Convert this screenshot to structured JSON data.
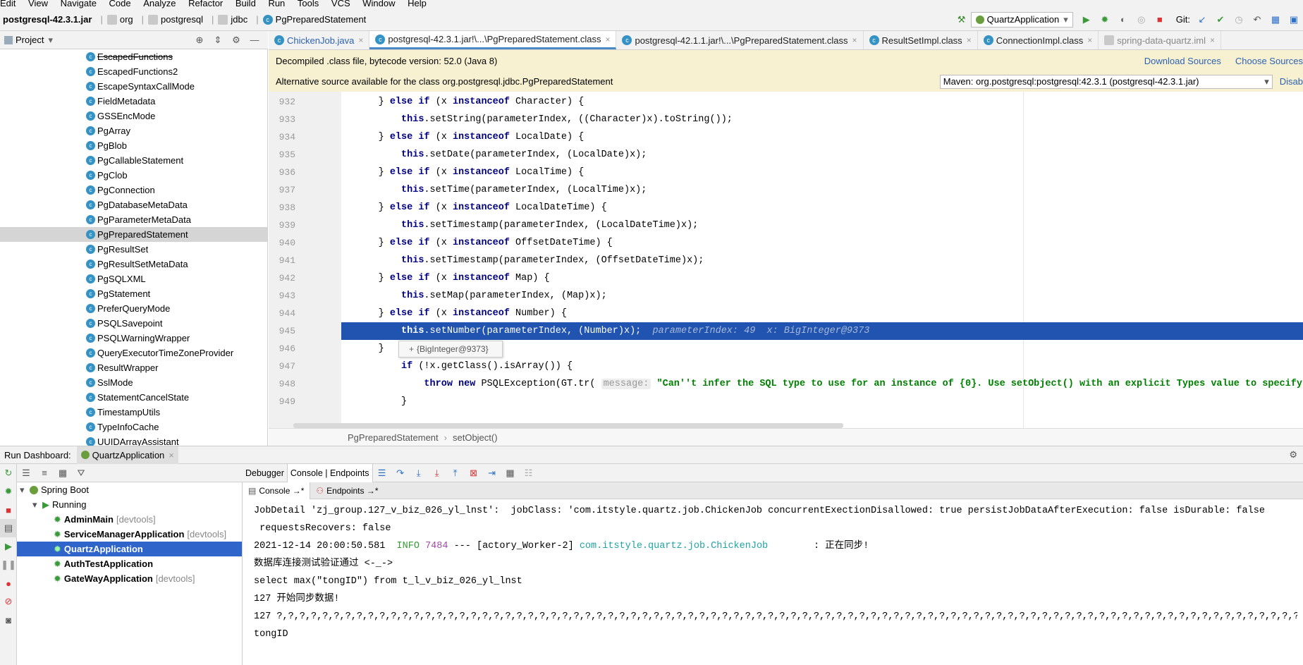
{
  "menu": [
    "Edit",
    "View",
    "Navigate",
    "Code",
    "Analyze",
    "Refactor",
    "Build",
    "Run",
    "Tools",
    "VCS",
    "Window",
    "Help"
  ],
  "nav": {
    "jar": "postgresql-42.3.1.jar",
    "p1": "org",
    "p2": "postgresql",
    "p3": "jdbc",
    "cls": "PgPreparedStatement",
    "run_config": "QuartzApplication",
    "git": "Git:"
  },
  "project": {
    "title": "Project",
    "items": [
      "EscapedFunctions",
      "EscapedFunctions2",
      "EscapeSyntaxCallMode",
      "FieldMetadata",
      "GSSEncMode",
      "PgArray",
      "PgBlob",
      "PgCallableStatement",
      "PgClob",
      "PgConnection",
      "PgDatabaseMetaData",
      "PgParameterMetaData",
      "PgPreparedStatement",
      "PgResultSet",
      "PgResultSetMetaData",
      "PgSQLXML",
      "PgStatement",
      "PreferQueryMode",
      "PSQLSavepoint",
      "PSQLWarningWrapper",
      "QueryExecutorTimeZoneProvider",
      "ResultWrapper",
      "SslMode",
      "StatementCancelState",
      "TimestampUtils",
      "TypeInfoCache",
      "UUIDArrayAssistant"
    ],
    "selected": 12
  },
  "tabs": [
    "ChickenJob.java",
    "postgresql-42.3.1.jar!\\...\\PgPreparedStatement.class",
    "postgresql-42.1.1.jar!\\...\\PgPreparedStatement.class",
    "ResultSetImpl.class",
    "ConnectionImpl.class",
    "spring-data-quartz.iml"
  ],
  "banner1": {
    "text": "Decompiled .class file, bytecode version: 52.0 (Java 8)",
    "download": "Download Sources",
    "choose": "Choose Sources"
  },
  "banner2": {
    "text": "Alternative source available for the class org.postgresql.jdbc.PgPreparedStatement",
    "select": "Maven: org.postgresql:postgresql:42.3.1 (postgresql-42.3.1.jar)",
    "disable": "Disab"
  },
  "code": {
    "lines": [
      "932",
      "933",
      "934",
      "935",
      "936",
      "937",
      "938",
      "939",
      "940",
      "941",
      "942",
      "943",
      "944",
      "945",
      "946",
      "947",
      "948",
      "949"
    ],
    "tooltip": "{BigInteger@9373}",
    "inline": "parameterIndex: 49  x: BigInteger@9373",
    "hint_label": "message:",
    "message_str": "\"Can''t infer the SQL type to use for an instance of {0}. Use setObject() with an explicit Types value to specify"
  },
  "breadcrumb": {
    "cls": "PgPreparedStatement",
    "method": "setObject()"
  },
  "run_dashboard": {
    "label": "Run Dashboard:",
    "app": "QuartzApplication",
    "spring_boot": "Spring Boot",
    "running": "Running",
    "apps": [
      {
        "name": "AdminMain",
        "tag": "[devtools]"
      },
      {
        "name": "ServiceManagerApplication",
        "tag": "[devtools]"
      },
      {
        "name": "QuartzApplication",
        "tag": ""
      },
      {
        "name": "AuthTestApplication",
        "tag": ""
      },
      {
        "name": "GateWayApplication",
        "tag": "[devtools]"
      }
    ]
  },
  "debug_tabs": {
    "debugger": "Debugger",
    "console": "Console | Endpoints",
    "sub_console": "Console →*",
    "sub_endpoints": "Endpoints →*"
  },
  "console_lines": [
    "JobDetail 'zj_group.127_v_biz_026_yl_lnst':  jobClass: 'com.itstyle.quartz.job.ChickenJob concurrentExectionDisallowed: true persistJobDataAfterExecution: false isDurable: false",
    " requestsRecovers: false",
    "2021-12-14 20:00:50.581  INFO 7484 --- [actory_Worker-2] com.itstyle.quartz.job.ChickenJob        : 正在同步!",
    "数据库连接测试验证通过 <-_->",
    "select max(\"tongID\") from t_l_v_biz_026_yl_lnst",
    "127 开始同步数据!",
    "127 ?,?,?,?,?,?,?,?,?,?,?,?,?,?,?,?,?,?,?,?,?,?,?,?,?,?,?,?,?,?,?,?,?,?,?,?,?,?,?,?,?,?,?,?,?,?,?,?,?,?,?,?,?,?,?,?,?,?,?,?,?,?,?,?,?,?,?,?,?,?,?,?,?,?,?,?,?,?,?,?,?,?,?,?,?,?,?,?,?,?,?,?,?,?,?,?,?,",
    "tongID"
  ]
}
